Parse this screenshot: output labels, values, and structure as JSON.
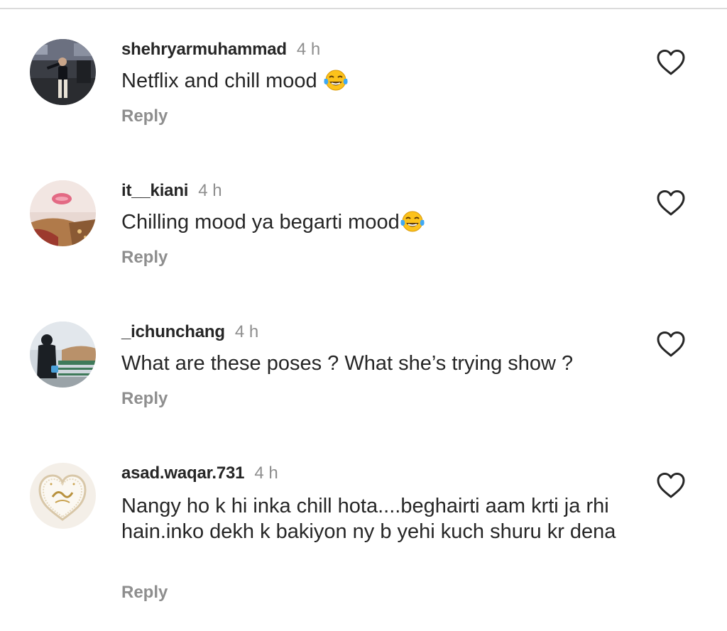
{
  "comments": [
    {
      "username": "shehryarmuhammad",
      "time": "4 h",
      "text": "Netflix and chill mood ",
      "emoji": "face-with-tears-of-joy",
      "reply": "Reply"
    },
    {
      "username": "it__kiani",
      "time": "4 h",
      "text": "Chilling mood ya begarti mood",
      "emoji": "face-with-tears-of-joy",
      "reply": "Reply"
    },
    {
      "username": "_ichunchang",
      "time": "4 h",
      "text": "What are these poses ? What she’s trying show ?",
      "reply": "Reply"
    },
    {
      "username": "asad.waqar.731",
      "time": "4 h",
      "text": "Nangy ho k hi inka chill hota....beghairti aam krti ja rhi hain.inko dekh k bakiyon ny b yehi kuch shuru kr dena",
      "reply": "Reply"
    }
  ],
  "icons": {
    "like": "heart-outline-icon"
  },
  "colors": {
    "text": "#262626",
    "secondary": "#8e8e8e",
    "divider": "#dbdbdb"
  }
}
